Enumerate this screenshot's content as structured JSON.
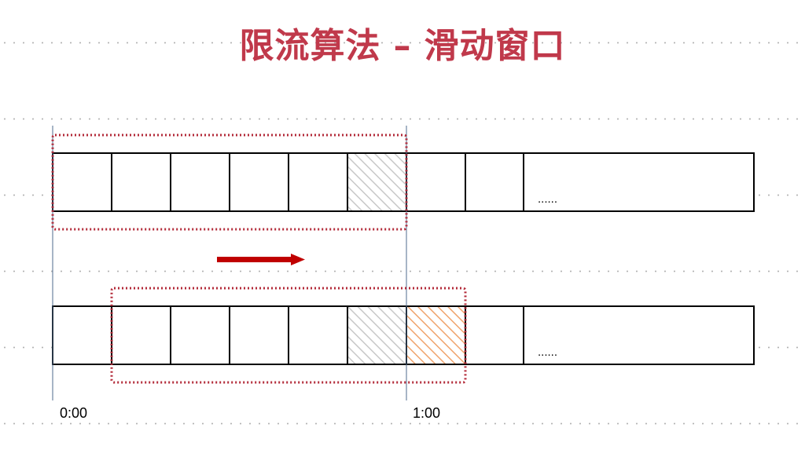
{
  "title": {
    "left": "限流算法",
    "separator": "–",
    "right": "滑动窗口"
  },
  "timeline": {
    "start_label": "0:00",
    "end_label": "1:00"
  },
  "rows": [
    {
      "ellipsis": "......",
      "hatched_cells": [
        {
          "index": 5,
          "style": "grey"
        }
      ]
    },
    {
      "ellipsis": "......",
      "hatched_cells": [
        {
          "index": 5,
          "style": "grey"
        },
        {
          "index": 6,
          "style": "orange"
        }
      ]
    }
  ],
  "colors": {
    "title": "#c0394b",
    "window_border": "#b32b3a",
    "arrow": "#c00000",
    "time_marker": "#4f6b8c",
    "hatch_grey": "#c8c8c8",
    "hatch_orange": "#f0a36b"
  }
}
